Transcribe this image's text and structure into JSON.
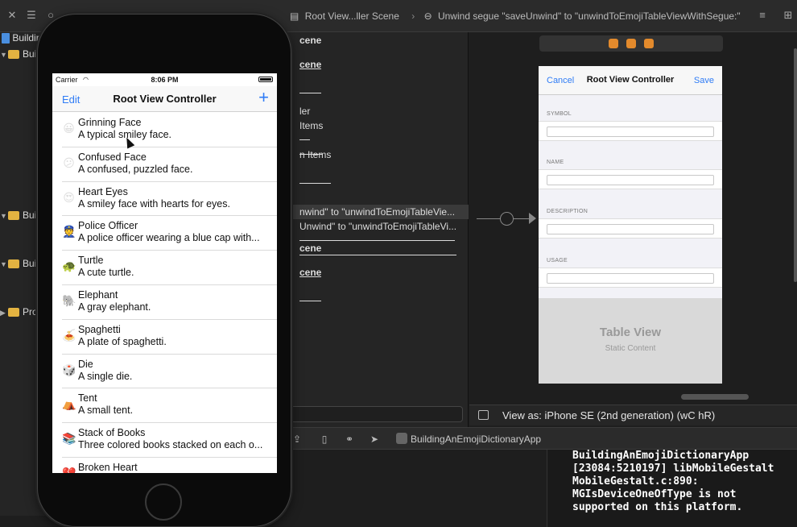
{
  "jump_bar": {
    "scene": "Root View...ller Scene",
    "segue": "Unwind segue \"saveUnwind\" to \"unwindToEmojiTableViewWithSegue:\""
  },
  "navigator": {
    "items": [
      "Buildin",
      "Buil",
      "Buil",
      "Buil",
      "Pro"
    ]
  },
  "outline": {
    "rows": [
      "cene",
      "cene",
      "ler",
      "Items",
      "n Items",
      "nwind\" to \"unwindToEmojiTableVie...",
      "Unwind\" to \"unwindToEmojiTableVi...",
      "cene",
      "cene"
    ]
  },
  "canvas": {
    "nav_left": "Cancel",
    "nav_title": "Root View Controller",
    "nav_right": "Save",
    "sections": [
      "SYMBOL",
      "NAME",
      "DESCRIPTION",
      "USAGE"
    ],
    "static_title": "Table View",
    "static_subtitle": "Static Content",
    "view_as": "View as: iPhone SE (2nd generation) (wC hR)"
  },
  "debug": {
    "app_name": "BuildingAnEmojiDictionaryApp"
  },
  "console": {
    "text": "BuildingAnEmojiDictionaryApp\n[23084:5210197] libMobileGestalt\nMobileGestalt.c:890:\nMGIsDeviceOneOfType is not\nsupported on this platform."
  },
  "simulator": {
    "carrier": "Carrier",
    "time": "8:06 PM",
    "nav": {
      "edit": "Edit",
      "title": "Root View Controller",
      "add": "+"
    },
    "rows": [
      {
        "emoji": "😀",
        "name": "Grinning Face",
        "desc": "A typical smiley face."
      },
      {
        "emoji": "😕",
        "name": "Confused Face",
        "desc": "A confused, puzzled face."
      },
      {
        "emoji": "😍",
        "name": "Heart Eyes",
        "desc": "A smiley face with hearts for eyes."
      },
      {
        "emoji": "👮",
        "name": "Police Officer",
        "desc": "A police officer wearing a blue cap with..."
      },
      {
        "emoji": "🐢",
        "name": "Turtle",
        "desc": "A cute turtle."
      },
      {
        "emoji": "🐘",
        "name": "Elephant",
        "desc": "A gray elephant."
      },
      {
        "emoji": "🍝",
        "name": "Spaghetti",
        "desc": "A plate of spaghetti."
      },
      {
        "emoji": "🎲",
        "name": "Die",
        "desc": "A single die."
      },
      {
        "emoji": "⛺",
        "name": "Tent",
        "desc": "A small tent."
      },
      {
        "emoji": "📚",
        "name": "Stack of Books",
        "desc": "Three colored books stacked on each o..."
      },
      {
        "emoji": "💔",
        "name": "Broken Heart",
        "desc": ""
      }
    ]
  },
  "colors": {
    "accent": "#2f7cf6",
    "folder": "#e3b341"
  }
}
